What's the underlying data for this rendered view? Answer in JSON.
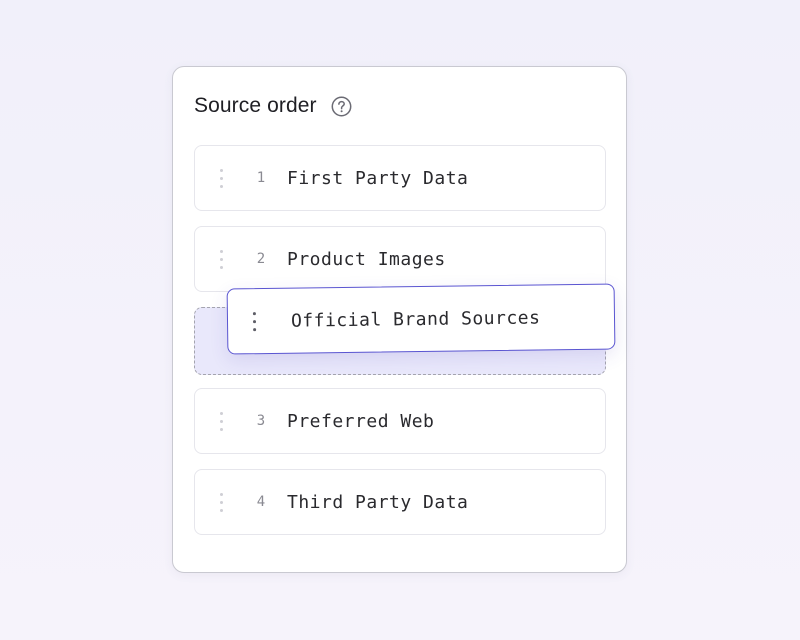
{
  "panel": {
    "title": "Source order",
    "help_icon": "question-circle-icon"
  },
  "sources": [
    {
      "number": "1",
      "label": "First Party Data"
    },
    {
      "number": "2",
      "label": "Product Images"
    },
    {
      "number": "3",
      "label": "Preferred Web"
    },
    {
      "number": "4",
      "label": "Third Party Data"
    }
  ],
  "dragging": {
    "label": "Official Brand Sources",
    "drop_position": "between item 2 and item 3"
  },
  "colors": {
    "accent": "#5a55d1",
    "drop_zone": "#e9e8fb",
    "background": "#f2f1fa"
  }
}
